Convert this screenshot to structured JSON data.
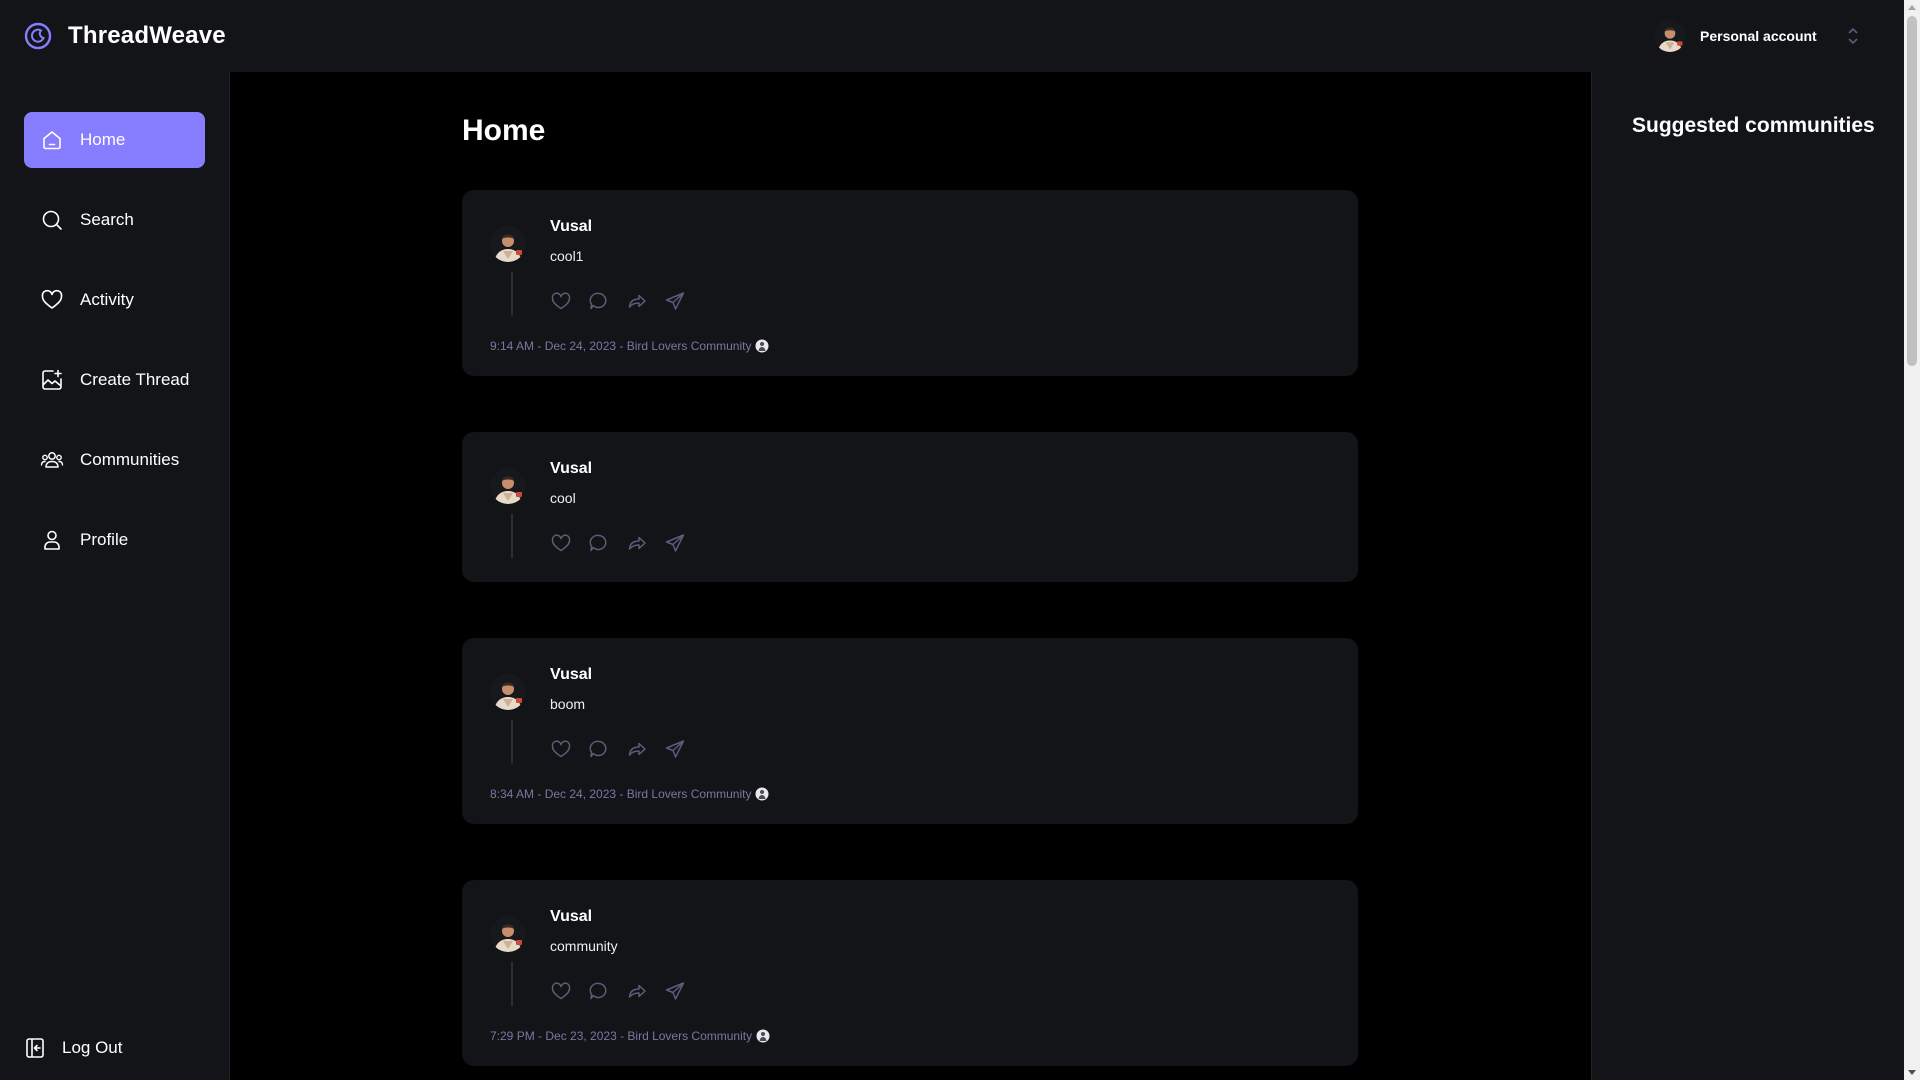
{
  "app": {
    "name": "ThreadWeave"
  },
  "account": {
    "label": "Personal account"
  },
  "nav": {
    "items": [
      {
        "label": "Home",
        "icon": "home-icon",
        "active": true
      },
      {
        "label": "Search",
        "icon": "search-icon"
      },
      {
        "label": "Activity",
        "icon": "heart-icon"
      },
      {
        "label": "Create Thread",
        "icon": "create-thread-icon"
      },
      {
        "label": "Communities",
        "icon": "communities-icon"
      },
      {
        "label": "Profile",
        "icon": "user-icon"
      }
    ],
    "logout": "Log Out"
  },
  "main": {
    "title": "Home",
    "posts": [
      {
        "author": "Vusal",
        "content": "cool1",
        "meta": "9:14 AM - Dec 24, 2023 - Bird Lovers Community"
      },
      {
        "author": "Vusal",
        "content": "cool",
        "meta": ""
      },
      {
        "author": "Vusal",
        "content": "boom",
        "meta": "8:34 AM - Dec 24, 2023 - Bird Lovers Community"
      },
      {
        "author": "Vusal",
        "content": "community",
        "meta": "7:29 PM - Dec 23, 2023 - Bird Lovers Community"
      }
    ]
  },
  "right": {
    "title": "Suggested communities"
  },
  "colors": {
    "accent": "#877eff",
    "surface": "#121417",
    "background": "#000000",
    "muted": "#7878a3"
  }
}
